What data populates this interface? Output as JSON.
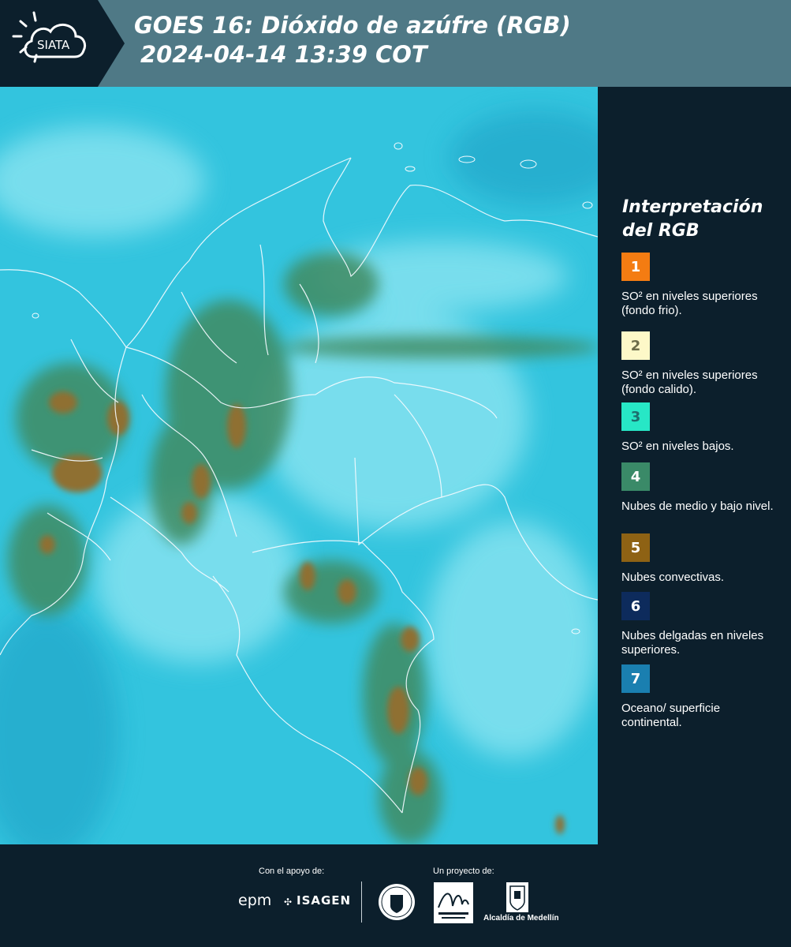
{
  "header": {
    "logo_text": "SIATA",
    "title_line1": "GOES 16: Dióxido de azúfre (RGB)",
    "title_line2": "2024-04-14 13:39 COT"
  },
  "legend": {
    "title": "Interpretación del RGB",
    "items": [
      {
        "number": "1",
        "color": "#f47c12",
        "text_color": "#ffffff",
        "text": "SO² en niveles superiores (fondo frio)."
      },
      {
        "number": "2",
        "color": "#fdf8c8",
        "text_color": "#6d6d4a",
        "text": "SO² en niveles superiores (fondo calido)."
      },
      {
        "number": "3",
        "color": "#27e7c6",
        "text_color": "#1d6e6e",
        "text": "SO² en niveles bajos."
      },
      {
        "number": "4",
        "color": "#3a8a68",
        "text_color": "#ffffff",
        "text": "Nubes de medio y bajo nivel."
      },
      {
        "number": "5",
        "color": "#8e6214",
        "text_color": "#ffffff",
        "text": "Nubes convectivas."
      },
      {
        "number": "6",
        "color": "#0d2b5c",
        "text_color": "#ffffff",
        "text": "Nubes delgadas en niveles superiores."
      },
      {
        "number": "7",
        "color": "#1a7fb0",
        "text_color": "#ffffff",
        "text": "Oceano/ superficie continental."
      }
    ]
  },
  "footer": {
    "support_label": "Con el apoyo de:",
    "project_label": "Un proyecto de:",
    "sponsor_epm": "epm",
    "sponsor_isagen": "ISAGEN",
    "partner_alcaldia": "Alcaldía de Medellín"
  }
}
